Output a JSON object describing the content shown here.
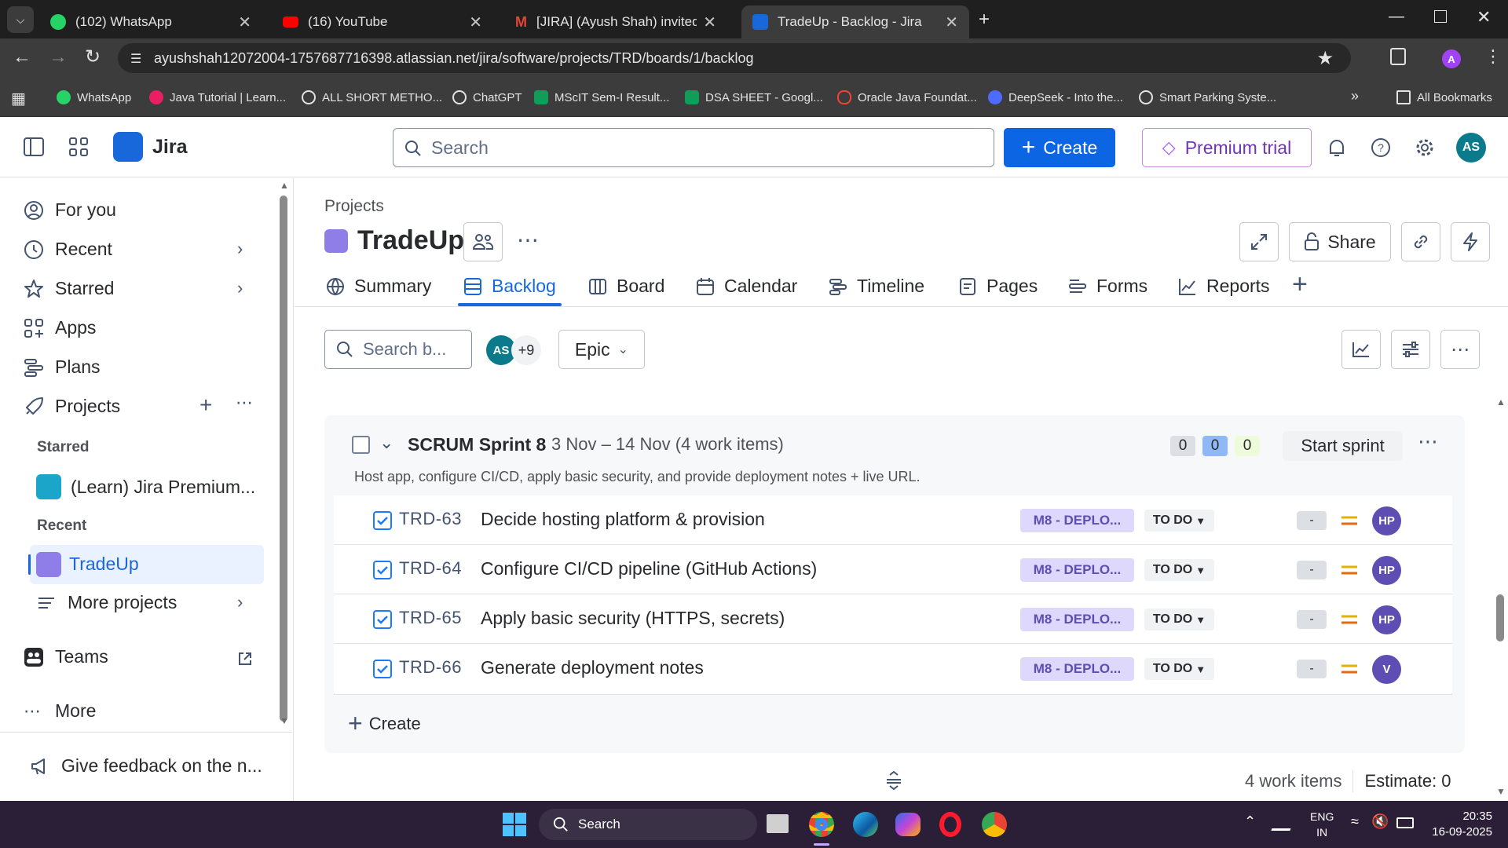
{
  "browser": {
    "tabs": [
      {
        "title": "(102) WhatsApp",
        "icon": "whatsapp-icon"
      },
      {
        "title": "(16) YouTube",
        "icon": "youtube-icon"
      },
      {
        "title": "[JIRA] (Ayush Shah) invited you",
        "icon": "gmail-icon"
      },
      {
        "title": "TradeUp - Backlog - Jira",
        "icon": "jira-icon"
      }
    ],
    "url": "ayushshah12072004-1757687716398.atlassian.net/jira/software/projects/TRD/boards/1/backlog",
    "profile_initial": "A",
    "bookmarks": [
      "WhatsApp",
      "Java Tutorial | Learn...",
      "ALL SHORT METHO...",
      "ChatGPT",
      "MScIT Sem-I Result...",
      "DSA SHEET - Googl...",
      "Oracle Java Foundat...",
      "DeepSeek - Into the...",
      "Smart Parking Syste..."
    ],
    "all_bookmarks": "All Bookmarks"
  },
  "header": {
    "app_name": "Jira",
    "search_placeholder": "Search",
    "create_label": "Create",
    "premium_label": "Premium trial",
    "user_initials": "AS"
  },
  "sidebar": {
    "items": {
      "for_you": "For you",
      "recent": "Recent",
      "starred": "Starred",
      "apps": "Apps",
      "plans": "Plans",
      "projects": "Projects"
    },
    "starred_heading": "Starred",
    "starred_project": "(Learn) Jira Premium...",
    "recent_heading": "Recent",
    "recent_project": "TradeUp",
    "more_projects": "More projects",
    "teams": "Teams",
    "more": "More",
    "feedback": "Give feedback on the n..."
  },
  "project": {
    "breadcrumb": "Projects",
    "name": "TradeUp",
    "share_label": "Share",
    "tabs": [
      "Summary",
      "Backlog",
      "Board",
      "Calendar",
      "Timeline",
      "Pages",
      "Forms",
      "Reports"
    ],
    "active_tab": "Backlog"
  },
  "toolbar": {
    "search_placeholder": "Search b...",
    "avatar_initials": "AS",
    "avatar_more": "+9",
    "epic_label": "Epic"
  },
  "sprint": {
    "name": "SCRUM Sprint 8",
    "dates": "3 Nov – 14 Nov (4 work items)",
    "counts": [
      "0",
      "0",
      "0"
    ],
    "start_label": "Start sprint",
    "goal": "Host app, configure CI/CD, apply basic security, and provide deployment notes + live URL.",
    "items": [
      {
        "key": "TRD-63",
        "summary": "Decide hosting platform & provision",
        "epic": "M8 - DEPLO...",
        "status": "TO DO",
        "estimate": "-",
        "assignee": "HP"
      },
      {
        "key": "TRD-64",
        "summary": "Configure CI/CD pipeline (GitHub Actions)",
        "epic": "M8 - DEPLO...",
        "status": "TO DO",
        "estimate": "-",
        "assignee": "HP"
      },
      {
        "key": "TRD-65",
        "summary": "Apply basic security (HTTPS, secrets)",
        "epic": "M8 - DEPLO...",
        "status": "TO DO",
        "estimate": "-",
        "assignee": "HP"
      },
      {
        "key": "TRD-66",
        "summary": "Generate deployment notes",
        "epic": "M8 - DEPLO...",
        "status": "TO DO",
        "estimate": "-",
        "assignee": "V"
      }
    ],
    "create_label": "Create"
  },
  "footer": {
    "work_items": "4 work items",
    "estimate": "Estimate: 0"
  },
  "taskbar": {
    "search_label": "Search",
    "lang_top": "ENG",
    "lang_bottom": "IN",
    "time": "20:35",
    "date": "16-09-2025"
  },
  "colors": {
    "primary": "#0c66e4",
    "premium": "#6e36b2",
    "epic_bg": "#dfd8fd",
    "assignee": "#5e4db2"
  }
}
